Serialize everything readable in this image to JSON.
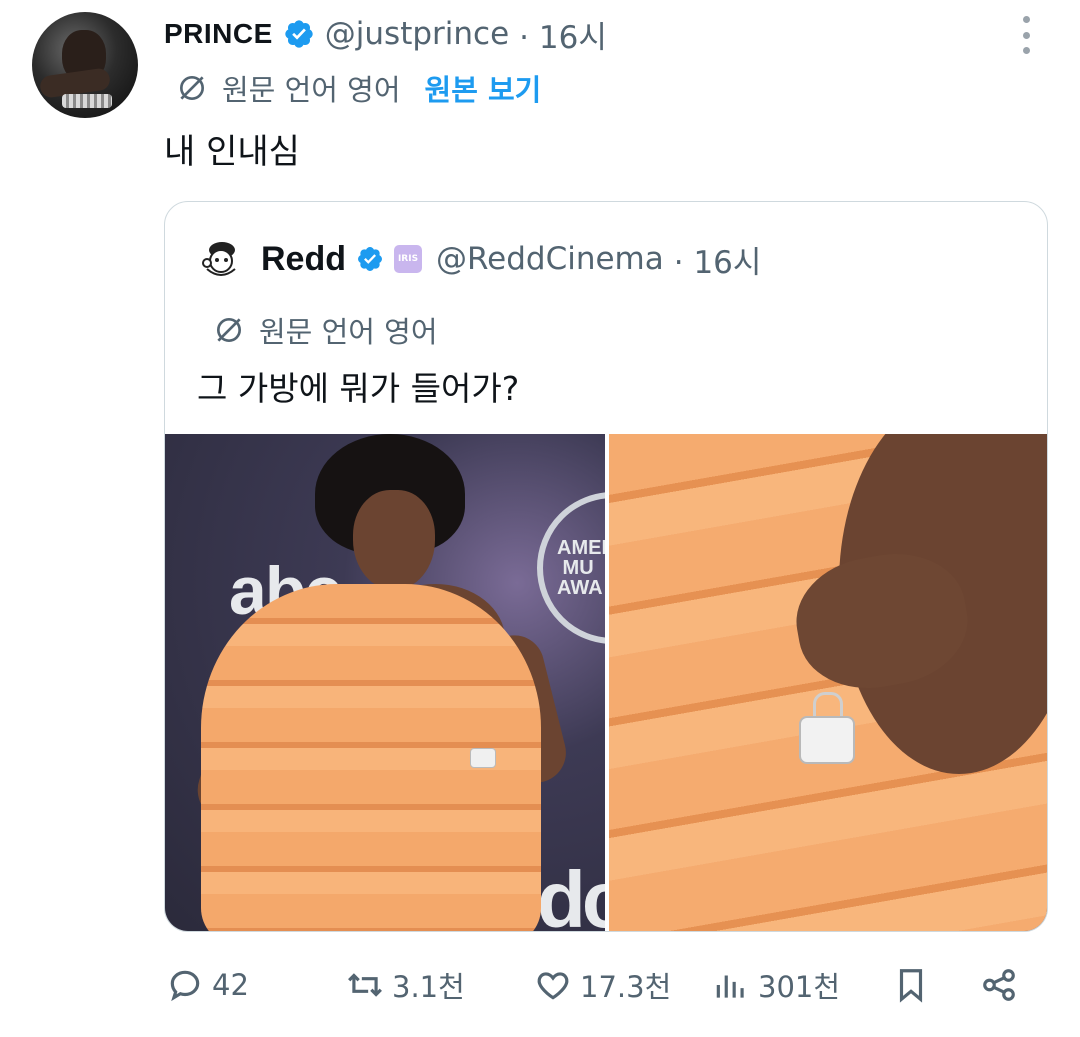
{
  "tweet": {
    "author_name": "PRINCE",
    "author_handle": "@justprince",
    "time": "· 16시",
    "translate": {
      "lang_label": "원문 언어 영어",
      "show_original": "원본 보기"
    },
    "text": "내 인내심"
  },
  "quote": {
    "author_name": "Redd",
    "badge_text": "IRIS",
    "author_handle": "@ReddCinema",
    "time": "· 16시",
    "translate_label": "원문 언어 영어",
    "text": "그 가방에 뭐가 들어가?",
    "media": {
      "left_logo": "abc",
      "left_award_text": "AMER\n MU\nAWA",
      "left_bottom_logo": "dc"
    }
  },
  "actions": {
    "replies": "42",
    "retweets": "3.1천",
    "likes": "17.3천",
    "views": "301천"
  },
  "colors": {
    "accent": "#1d9bf0",
    "secondary_text": "#536471",
    "border": "#cfd9de"
  },
  "icons": [
    "verified-icon",
    "translate-icon",
    "more-icon",
    "reply-icon",
    "retweet-icon",
    "like-icon",
    "views-icon",
    "bookmark-icon",
    "share-icon"
  ]
}
